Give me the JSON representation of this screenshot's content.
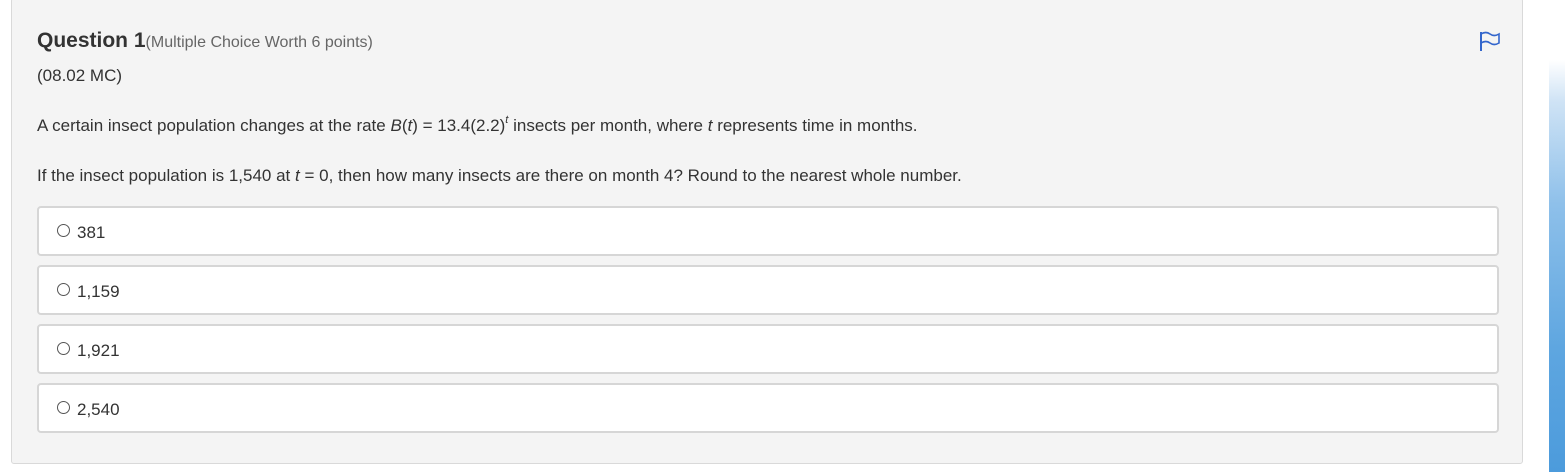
{
  "question": {
    "title": "Question 1",
    "worth": "(Multiple Choice Worth 6 points)",
    "code": "(08.02 MC)",
    "stem1": {
      "before_fn": "A certain insect population changes at the rate ",
      "fn_name": "B",
      "fn_open": "(",
      "fn_var": "t",
      "fn_eq": ") = 13.4(2.2)",
      "exponent": "t",
      "after": " insects per month, where ",
      "var": "t",
      "end": " represents time in months."
    },
    "stem2": {
      "before": "If the insect population is 1,540 at ",
      "var": "t",
      "after": " = 0, then how many insects are there on month 4? Round to the nearest whole number."
    },
    "choices": [
      {
        "label": "381"
      },
      {
        "label": "1,159"
      },
      {
        "label": "1,921"
      },
      {
        "label": "2,540"
      }
    ],
    "flag_color": "#3366cc",
    "flag_icon": "flag-icon"
  }
}
